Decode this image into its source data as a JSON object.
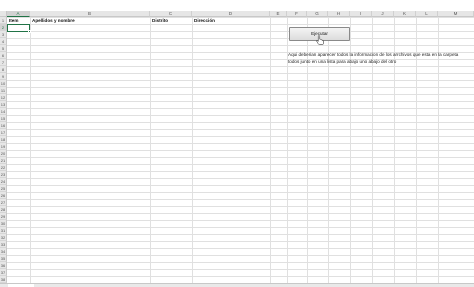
{
  "columns": [
    "A",
    "B",
    "C",
    "D",
    "E",
    "F",
    "G",
    "H",
    "I",
    "J",
    "K",
    "L",
    "M"
  ],
  "rows": [
    "1",
    "2",
    "3",
    "4",
    "5",
    "6",
    "7",
    "8",
    "9",
    "10",
    "11",
    "12",
    "13",
    "14",
    "15",
    "16",
    "17",
    "18",
    "19",
    "20",
    "21",
    "22",
    "23",
    "24",
    "25",
    "26",
    "27",
    "28",
    "29",
    "30",
    "31",
    "32",
    "33",
    "34",
    "35",
    "36",
    "37",
    "38"
  ],
  "headers_row": {
    "item": "Item",
    "apellidos": "Apellidos y nombre",
    "distrito": "Distrito",
    "direccion": "Dirección"
  },
  "button": {
    "label": "Ejecutar"
  },
  "note": {
    "line1": "Aqui deberian aparecer todos la informacion de los arrchivos que esta en la carpeta",
    "line2": "todos junto en una lista para abajo uno abajo del otro"
  },
  "selection": {
    "cell": "A2"
  },
  "colors": {
    "accent": "#217346",
    "grid": "#e0e0e0",
    "header_bg": "#e6e6e6"
  },
  "icons": {
    "cursor": "hand-pointer-icon"
  }
}
